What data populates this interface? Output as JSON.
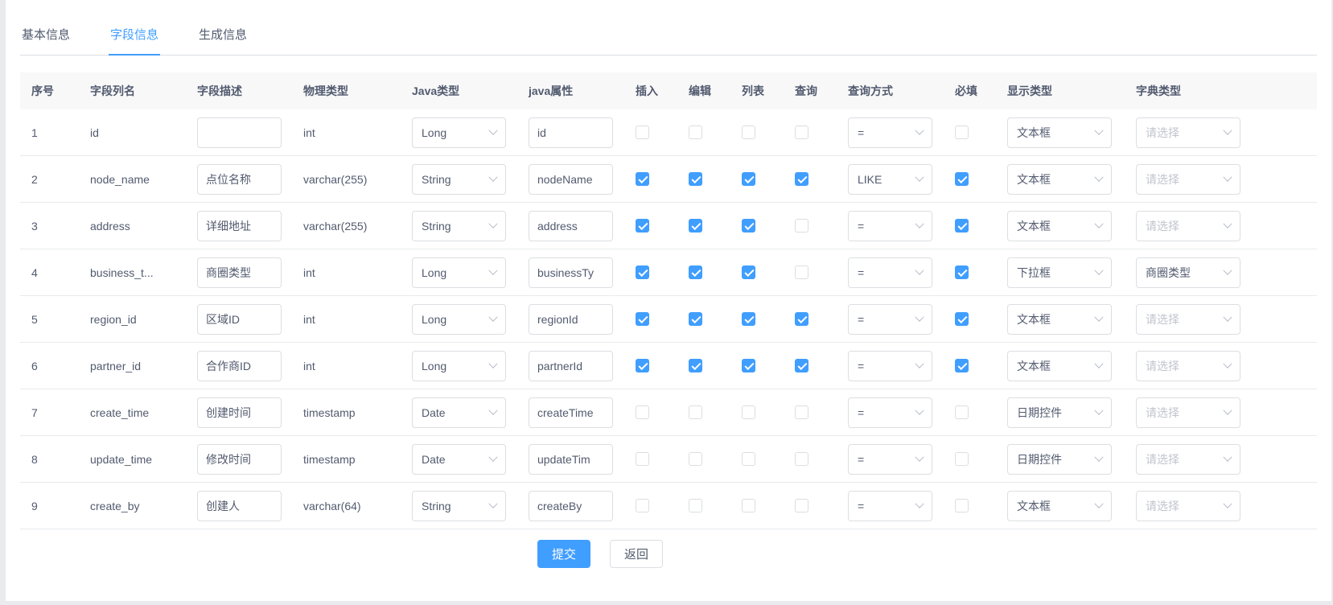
{
  "tabs": [
    {
      "label": "基本信息",
      "active": false
    },
    {
      "label": "字段信息",
      "active": true
    },
    {
      "label": "生成信息",
      "active": false
    }
  ],
  "table": {
    "headers": [
      "序号",
      "字段列名",
      "字段描述",
      "物理类型",
      "Java类型",
      "java属性",
      "插入",
      "编辑",
      "列表",
      "查询",
      "查询方式",
      "必填",
      "显示类型",
      "字典类型"
    ],
    "dict_placeholder_text": "请选择",
    "rows": [
      {
        "no": "1",
        "column": "id",
        "desc": "",
        "physical": "int",
        "java_type": "Long",
        "java_attr": "id",
        "insert": false,
        "edit": false,
        "list": false,
        "query": false,
        "query_mode": "=",
        "required": false,
        "display": "文本框",
        "dict": "请选择",
        "dict_placeholder": true
      },
      {
        "no": "2",
        "column": "node_name",
        "desc": "点位名称",
        "physical": "varchar(255)",
        "java_type": "String",
        "java_attr": "nodeName",
        "insert": true,
        "edit": true,
        "list": true,
        "query": true,
        "query_mode": "LIKE",
        "required": true,
        "display": "文本框",
        "dict": "请选择",
        "dict_placeholder": true
      },
      {
        "no": "3",
        "column": "address",
        "desc": "详细地址",
        "physical": "varchar(255)",
        "java_type": "String",
        "java_attr": "address",
        "insert": true,
        "edit": true,
        "list": true,
        "query": false,
        "query_mode": "=",
        "required": true,
        "display": "文本框",
        "dict": "请选择",
        "dict_placeholder": true
      },
      {
        "no": "4",
        "column": "business_t...",
        "desc": "商圈类型",
        "physical": "int",
        "java_type": "Long",
        "java_attr": "businessTy",
        "insert": true,
        "edit": true,
        "list": true,
        "query": false,
        "query_mode": "=",
        "required": true,
        "display": "下拉框",
        "dict": "商圈类型",
        "dict_placeholder": false
      },
      {
        "no": "5",
        "column": "region_id",
        "desc": "区域ID",
        "physical": "int",
        "java_type": "Long",
        "java_attr": "regionId",
        "insert": true,
        "edit": true,
        "list": true,
        "query": true,
        "query_mode": "=",
        "required": true,
        "display": "文本框",
        "dict": "请选择",
        "dict_placeholder": true
      },
      {
        "no": "6",
        "column": "partner_id",
        "desc": "合作商ID",
        "physical": "int",
        "java_type": "Long",
        "java_attr": "partnerId",
        "insert": true,
        "edit": true,
        "list": true,
        "query": true,
        "query_mode": "=",
        "required": true,
        "display": "文本框",
        "dict": "请选择",
        "dict_placeholder": true
      },
      {
        "no": "7",
        "column": "create_time",
        "desc": "创建时间",
        "physical": "timestamp",
        "java_type": "Date",
        "java_attr": "createTime",
        "insert": false,
        "edit": false,
        "list": false,
        "query": false,
        "query_mode": "=",
        "required": false,
        "display": "日期控件",
        "dict": "请选择",
        "dict_placeholder": true
      },
      {
        "no": "8",
        "column": "update_time",
        "desc": "修改时间",
        "physical": "timestamp",
        "java_type": "Date",
        "java_attr": "updateTim",
        "insert": false,
        "edit": false,
        "list": false,
        "query": false,
        "query_mode": "=",
        "required": false,
        "display": "日期控件",
        "dict": "请选择",
        "dict_placeholder": true
      },
      {
        "no": "9",
        "column": "create_by",
        "desc": "创建人",
        "physical": "varchar(64)",
        "java_type": "String",
        "java_attr": "createBy",
        "insert": false,
        "edit": false,
        "list": false,
        "query": false,
        "query_mode": "=",
        "required": false,
        "display": "文本框",
        "dict": "请选择",
        "dict_placeholder": true
      }
    ]
  },
  "footer": {
    "submit_label": "提交",
    "back_label": "返回"
  },
  "colors": {
    "accent": "#409eff",
    "header_bg": "#f8f8f9",
    "border": "#dcdee2",
    "row_divider": "#e8eaec",
    "placeholder_text": "#c0c4cc"
  }
}
